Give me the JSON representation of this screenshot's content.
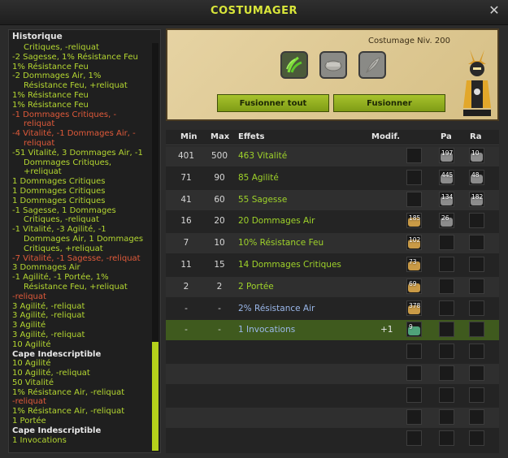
{
  "window": {
    "title": "COSTUMAGER"
  },
  "history": {
    "title": "Historique",
    "lines": [
      {
        "text": "Critiques, -reliquat",
        "cls": "i1"
      },
      {
        "text": "-2 Sagesse, 1% Résistance Feu",
        "cls": ""
      },
      {
        "text": "1% Résistance Feu",
        "cls": ""
      },
      {
        "text": "-2 Dommages Air, 1%",
        "cls": ""
      },
      {
        "text": "Résistance Feu, +reliquat",
        "cls": "i1"
      },
      {
        "text": "1% Résistance Feu",
        "cls": ""
      },
      {
        "text": "1% Résistance Feu",
        "cls": ""
      },
      {
        "text": "-1 Dommages Critiques, -",
        "cls": "red"
      },
      {
        "text": "reliquat",
        "cls": "red i1"
      },
      {
        "text": "-4 Vitalité, -1 Dommages Air, -",
        "cls": "red"
      },
      {
        "text": "reliquat",
        "cls": "red i1"
      },
      {
        "text": "-51 Vitalité, 3 Dommages Air, -1",
        "cls": ""
      },
      {
        "text": "Dommages Critiques,",
        "cls": "i1"
      },
      {
        "text": "+reliquat",
        "cls": "i1"
      },
      {
        "text": "1 Dommages Critiques",
        "cls": ""
      },
      {
        "text": "1 Dommages Critiques",
        "cls": ""
      },
      {
        "text": "1 Dommages Critiques",
        "cls": ""
      },
      {
        "text": "-1 Sagesse, 1 Dommages",
        "cls": ""
      },
      {
        "text": "Critiques, -reliquat",
        "cls": "i1"
      },
      {
        "text": "-1 Vitalité, -3 Agilité, -1",
        "cls": ""
      },
      {
        "text": "Dommages Air, 1 Dommages",
        "cls": "i1"
      },
      {
        "text": "Critiques, +reliquat",
        "cls": "i1"
      },
      {
        "text": "-7 Vitalité, -1 Sagesse, -reliquat",
        "cls": "red"
      },
      {
        "text": "3 Dommages Air",
        "cls": ""
      },
      {
        "text": "-1 Agilité, -1 Portée, 1%",
        "cls": ""
      },
      {
        "text": "Résistance Feu, +reliquat",
        "cls": "i1"
      },
      {
        "text": "-reliquat",
        "cls": "red"
      },
      {
        "text": "3 Agilité, -reliquat",
        "cls": ""
      },
      {
        "text": "3 Agilité, -reliquat",
        "cls": ""
      },
      {
        "text": "3 Agilité",
        "cls": ""
      },
      {
        "text": "3 Agilité, -reliquat",
        "cls": ""
      },
      {
        "text": "10 Agilité",
        "cls": ""
      },
      {
        "text": "Cape Indescriptible",
        "cls": "wh"
      },
      {
        "text": "10 Agilité",
        "cls": ""
      },
      {
        "text": "10 Agilité, -reliquat",
        "cls": ""
      },
      {
        "text": "50 Vitalité",
        "cls": ""
      },
      {
        "text": "1% Résistance Air, -reliquat",
        "cls": ""
      },
      {
        "text": "-reliquat",
        "cls": "red"
      },
      {
        "text": "1% Résistance Air, -reliquat",
        "cls": ""
      },
      {
        "text": "1 Portée",
        "cls": ""
      },
      {
        "text": "Cape Indescriptible",
        "cls": "wh"
      },
      {
        "text": "1 Invocations",
        "cls": ""
      }
    ]
  },
  "forge": {
    "level_label": "Costumage Niv. 200",
    "slots": [
      "green-claw-item-icon",
      "stone-rune-icon",
      "feather-icon"
    ],
    "fuse_all_label": "Fusionner tout",
    "fuse_label": "Fusionner"
  },
  "table": {
    "headers": {
      "min": "Min",
      "max": "Max",
      "effects": "Effets",
      "modif": "Modif.",
      "pa": "Pa",
      "ra": "Ra"
    },
    "rows": [
      {
        "min": "401",
        "max": "500",
        "effect": "463 Vitalité",
        "color": "green",
        "modif": "",
        "runes": [
          null,
          "197",
          "10"
        ]
      },
      {
        "min": "71",
        "max": "90",
        "effect": "85 Agilité",
        "color": "green",
        "modif": "",
        "runes": [
          null,
          "445",
          "48"
        ]
      },
      {
        "min": "41",
        "max": "60",
        "effect": "55 Sagesse",
        "color": "green",
        "modif": "",
        "runes": [
          null,
          "134",
          "182"
        ]
      },
      {
        "min": "16",
        "max": "20",
        "effect": "20 Dommages Air",
        "color": "green",
        "modif": "",
        "runes": [
          "185",
          "26",
          null
        ]
      },
      {
        "min": "7",
        "max": "10",
        "effect": "10% Résistance Feu",
        "color": "green",
        "modif": "",
        "runes": [
          "102",
          null,
          null
        ]
      },
      {
        "min": "11",
        "max": "15",
        "effect": "14 Dommages Critiques",
        "color": "green",
        "modif": "",
        "runes": [
          "73",
          null,
          null
        ]
      },
      {
        "min": "2",
        "max": "2",
        "effect": "2 Portée",
        "color": "green",
        "modif": "",
        "runes": [
          "69",
          null,
          null
        ]
      },
      {
        "min": "-",
        "max": "-",
        "effect": "2% Résistance Air",
        "color": "blue",
        "modif": "",
        "runes": [
          "378",
          null,
          null
        ]
      },
      {
        "min": "-",
        "max": "-",
        "effect": "1 Invocations",
        "color": "blue",
        "modif": "+1",
        "runes": [
          "9",
          null,
          null
        ],
        "highlight": true
      },
      {
        "min": "",
        "max": "",
        "effect": "",
        "color": "",
        "modif": "",
        "runes": [
          null,
          null,
          null
        ]
      },
      {
        "min": "",
        "max": "",
        "effect": "",
        "color": "",
        "modif": "",
        "runes": [
          null,
          null,
          null
        ]
      },
      {
        "min": "",
        "max": "",
        "effect": "",
        "color": "",
        "modif": "",
        "runes": [
          null,
          null,
          null
        ]
      },
      {
        "min": "",
        "max": "",
        "effect": "",
        "color": "",
        "modif": "",
        "runes": [
          null,
          null,
          null
        ]
      },
      {
        "min": "",
        "max": "",
        "effect": "",
        "color": "",
        "modif": "",
        "runes": [
          null,
          null,
          null
        ]
      }
    ]
  },
  "colors": {
    "accent": "#b5d11b",
    "green_text": "#9fd32a",
    "blue_text": "#9bb8ea",
    "red_text": "#e05a3a"
  }
}
